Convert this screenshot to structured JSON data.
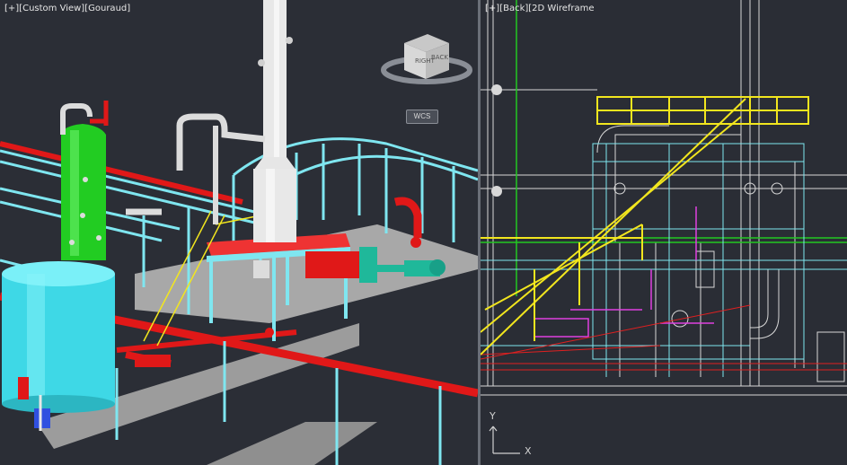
{
  "left_viewport": {
    "controls": "[+]",
    "view": "[Custom View]",
    "style": "[Gouraud]",
    "viewcube": {
      "right_face": "RIGHT",
      "back_face": "BACK"
    },
    "wcs_label": "WCS"
  },
  "right_viewport": {
    "controls": "[+]",
    "view": "[Back]",
    "style": "[2D Wireframe"
  },
  "ucs_icon": {
    "x_label": "X",
    "y_label": "Y"
  },
  "colors": {
    "background": "#2b2e36",
    "pipe_red": "#e01818",
    "steel_cyan": "#7fe6f0",
    "vessel_green": "#22cc22",
    "tank_cyan": "#3ed8e6",
    "stack_white": "#e8e8e8",
    "walkway_yellow": "#f2e61e",
    "wire_magenta": "#e040e0"
  }
}
